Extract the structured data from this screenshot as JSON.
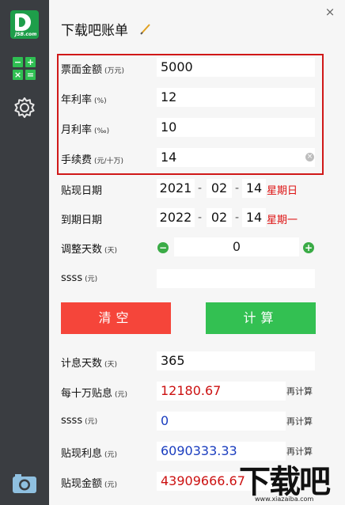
{
  "sidebar": {
    "logo_text": "JSB.com",
    "icons": [
      "calculator-icon",
      "gear-icon",
      "camera-icon"
    ]
  },
  "window": {
    "title": "下载吧账单",
    "close": "×"
  },
  "fields": {
    "face_amount": {
      "label": "票面金额",
      "unit": "(万元)",
      "value": "5000"
    },
    "annual_rate": {
      "label": "年利率",
      "unit": "(%)",
      "value": "12"
    },
    "monthly_rate": {
      "label": "月利率",
      "unit": "(‰)",
      "value": "10"
    },
    "fee": {
      "label": "手续费",
      "unit": "(元/十万)",
      "value": "14"
    }
  },
  "discount_date": {
    "label": "贴现日期",
    "year": "2021",
    "month": "02",
    "day": "14",
    "weekday": "星期日"
  },
  "due_date": {
    "label": "到期日期",
    "year": "2022",
    "month": "02",
    "day": "14",
    "weekday": "星期一"
  },
  "adjust_days": {
    "label": "调整天数",
    "unit": "(天)",
    "value": "0",
    "minus": "−",
    "plus": "+"
  },
  "ssss_input": {
    "label": "ssss",
    "unit": "(元)",
    "value": ""
  },
  "buttons": {
    "clear": "清空",
    "calculate": "计算"
  },
  "results": {
    "interest_days": {
      "label": "计息天数",
      "unit": "(天)",
      "value": "365"
    },
    "per_100k": {
      "label": "每十万贴息",
      "unit": "(元)",
      "value": "12180.67",
      "action": "再计算"
    },
    "ssss": {
      "label": "ssss",
      "unit": "(元)",
      "value": "0",
      "action": "再计算"
    },
    "discount_interest": {
      "label": "贴现利息",
      "unit": "(元)",
      "value": "6090333.33",
      "action": "再计算"
    },
    "discount_amount": {
      "label": "贴现金额",
      "unit": "(元)",
      "value": "43909666.67"
    }
  },
  "watermark": {
    "text": "下载吧",
    "url": "www.xiazaiba.com"
  },
  "colors": {
    "accent_green": "#33c052",
    "accent_red": "#f5453a",
    "highlight_box": "#d01818",
    "weekday_red": "#dd1111",
    "blue_value": "#1a3dbf",
    "red_value": "#cc1111"
  }
}
